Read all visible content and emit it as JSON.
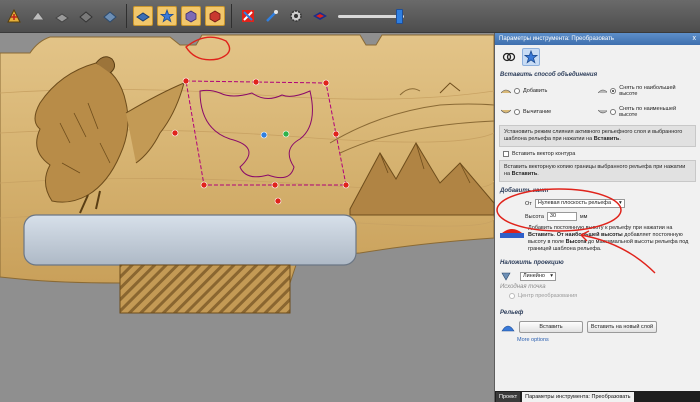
{
  "panel": {
    "title": "Параметры инструмента: Преобразовать",
    "close_glyph": "x",
    "combine": {
      "section_title": "Вставить способ объединения",
      "options": [
        {
          "label": "Добавить",
          "selected": false
        },
        {
          "label": "Снять по наибольшей высоте",
          "selected": true
        },
        {
          "label": "Вычитание",
          "selected": false
        },
        {
          "label": "Снять по наименьшей высоте",
          "selected": false
        }
      ],
      "info_prefix": "Установить режим слияния активного рельефного слоя и выбранного шаблона рельефа при нажатии на ",
      "info_bold": "Вставить",
      "info_suffix": "."
    },
    "vector": {
      "checkbox_label": "Вставить вектор контура",
      "checked": false,
      "info_prefix": "Вставить векторную копию границы выбранного рельефа при нажатии на ",
      "info_bold": "Вставить",
      "info_suffix": "."
    },
    "base": {
      "section_title": "Добавить кант",
      "from_label": "От",
      "from_value": "Нулевая плоскость рельефа",
      "height_label": "Высота",
      "height_value": "30",
      "unit": "мм",
      "info_part1": "Добавить постоянную высоту к рельефу при нажатии на ",
      "info_bold1": "Вставить",
      "info_part2": ". ",
      "info_bold2": "От наибольшей высоты",
      "info_part3": " добавляет постоянную высоту в поле ",
      "info_bold3": "Высота",
      "info_part4": " до максимальной высоты рельефа под границей шаблона рельефа."
    },
    "projection": {
      "section_title": "Наложить проекцию",
      "mode_value": "Линейно",
      "origin_title": "Исходная точка",
      "origin_option": "Центр преобразования"
    },
    "relief": {
      "section_title": "Рельеф",
      "paste_button": "Вставить",
      "paste_new_layer_button": "Вставить на новый слой",
      "more_options": "More options"
    },
    "tabs": [
      {
        "label": "Проект",
        "active": false
      },
      {
        "label": "Параметры инструмента: Преобразовать",
        "active": true
      }
    ]
  },
  "toolbar": {
    "icons": [
      "pan-icon",
      "view-icon",
      "iso-view-icon",
      "shaded-view-icon",
      "top-view-icon",
      "toggle-layer-icon",
      "star-icon",
      "cube-icon",
      "red-cube-icon",
      "split-icon",
      "brush-icon",
      "gear-icon",
      "diamond-icon",
      "brightness-slider"
    ],
    "slider_level": 0.9
  },
  "colors": {
    "wood": "#d9b978",
    "wood_dark": "#b8904a",
    "accent_red": "#e0231b",
    "accent_blue": "#2f7fe0",
    "panel_title": "#4a7dbe"
  }
}
